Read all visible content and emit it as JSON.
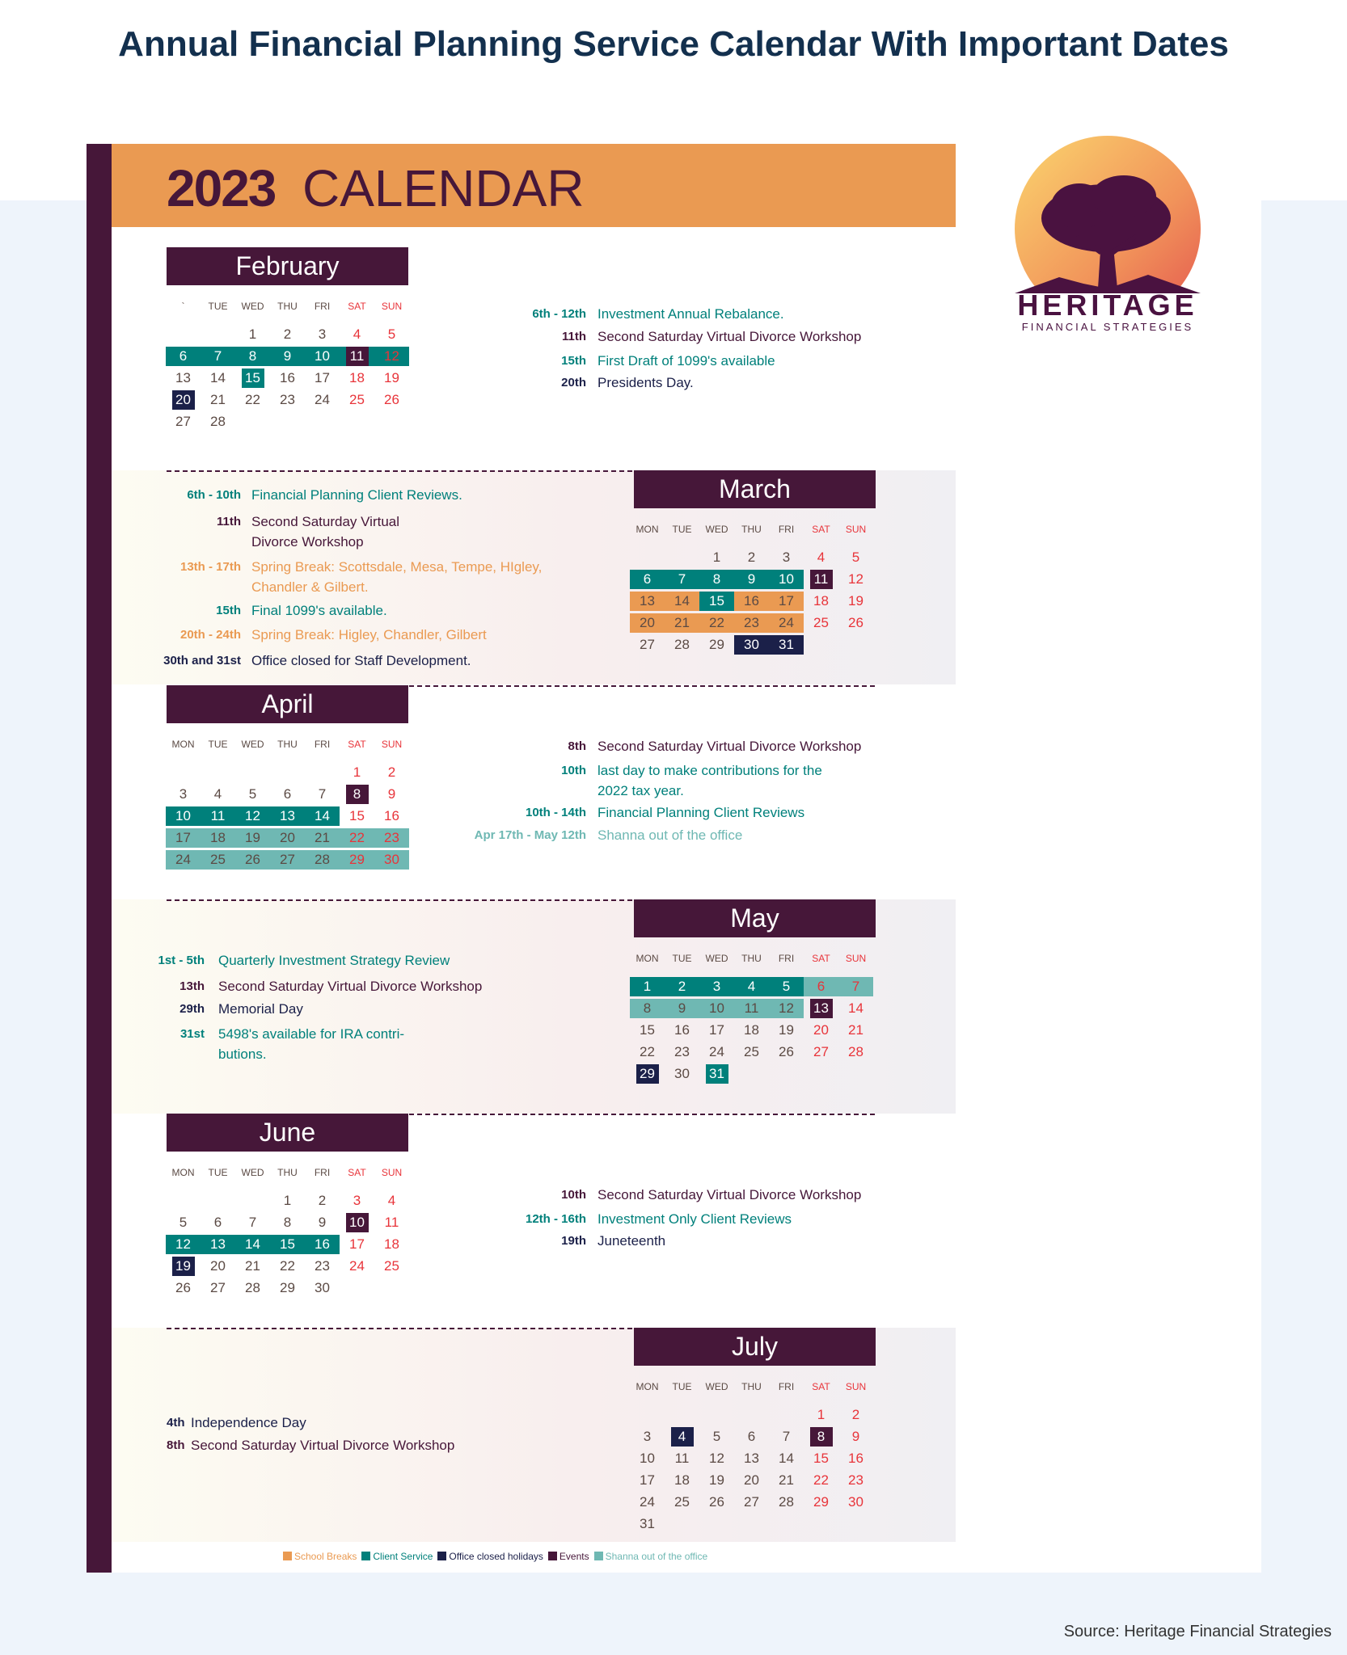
{
  "title": "Annual Financial Planning Service Calendar With Important Dates",
  "header": {
    "year": "2023",
    "label": "CALENDAR"
  },
  "logo": {
    "name": "HERITAGE",
    "tagline": "FINANCIAL STRATEGIES"
  },
  "colors": {
    "client": "#00807b",
    "events": "#461739",
    "office": "#1b2049",
    "school": "#ea9a52",
    "shanna": "#6fb8b3",
    "weekend": "#e8343a",
    "text": "#5b4a44"
  },
  "months": [
    {
      "name": "February",
      "weekdays": [
        "`",
        "TUE",
        "WED",
        "THU",
        "FRI",
        "SAT",
        "SUN"
      ],
      "offset": 2,
      "days": 28,
      "highlights": [
        {
          "from": 6,
          "to": 12,
          "cat": "client"
        },
        {
          "from": 11,
          "to": 11,
          "cat": "events"
        },
        {
          "from": 15,
          "to": 15,
          "cat": "client"
        },
        {
          "from": 20,
          "to": 20,
          "cat": "office"
        }
      ],
      "notes": [
        {
          "date": "6th - 12th",
          "lines": [
            "Investment Annual Rebalance."
          ],
          "cat": "client"
        },
        {
          "date": "11th",
          "lines": [
            "Second Saturday Virtual Divorce Workshop"
          ],
          "cat": "events"
        },
        {
          "date": "15th",
          "lines": [
            "First Draft of 1099's available"
          ],
          "cat": "client"
        },
        {
          "date": "20th",
          "lines": [
            "Presidents Day."
          ],
          "cat": "office"
        }
      ]
    },
    {
      "name": "March",
      "weekdays": [
        "MON",
        "TUE",
        "WED",
        "THU",
        "FRI",
        "SAT",
        "SUN"
      ],
      "offset": 2,
      "days": 31,
      "highlights": [
        {
          "from": 6,
          "to": 10,
          "cat": "client"
        },
        {
          "from": 11,
          "to": 11,
          "cat": "events"
        },
        {
          "from": 13,
          "to": 17,
          "cat": "school"
        },
        {
          "from": 15,
          "to": 15,
          "cat": "clientfull"
        },
        {
          "from": 20,
          "to": 24,
          "cat": "school"
        },
        {
          "from": 30,
          "to": 31,
          "cat": "office"
        }
      ],
      "notes": [
        {
          "date": "6th - 10th",
          "lines": [
            "Financial Planning Client Reviews."
          ],
          "cat": "client"
        },
        {
          "date": "11th",
          "lines": [
            "Second Saturday Virtual",
            "Divorce Workshop"
          ],
          "cat": "events"
        },
        {
          "date": "13th - 17th",
          "lines": [
            "Spring Break: Scottsdale, Mesa, Tempe, HIgley,",
            "Chandler & Gilbert."
          ],
          "cat": "school"
        },
        {
          "date": "15th",
          "lines": [
            "Final 1099's available."
          ],
          "cat": "client"
        },
        {
          "date": "20th - 24th",
          "lines": [
            "Spring Break: Higley, Chandler, Gilbert"
          ],
          "cat": "school"
        },
        {
          "date": "30th and 31st",
          "lines": [
            "Office closed for Staff Development."
          ],
          "cat": "office"
        }
      ]
    },
    {
      "name": "April",
      "weekdays": [
        "MON",
        "TUE",
        "WED",
        "THU",
        "FRI",
        "SAT",
        "SUN"
      ],
      "offset": 5,
      "days": 30,
      "highlights": [
        {
          "from": 8,
          "to": 8,
          "cat": "events"
        },
        {
          "from": 10,
          "to": 14,
          "cat": "client"
        },
        {
          "from": 17,
          "to": 30,
          "cat": "shanna"
        }
      ],
      "notes": [
        {
          "date": "8th",
          "lines": [
            "Second Saturday Virtual Divorce Workshop"
          ],
          "cat": "events"
        },
        {
          "date": "10th",
          "lines": [
            "last day to make contributions for the",
            "2022 tax year."
          ],
          "cat": "client"
        },
        {
          "date": "10th - 14th",
          "lines": [
            "Financial Planning Client Reviews"
          ],
          "cat": "client"
        },
        {
          "date": "Apr 17th - May 12th",
          "lines": [
            "Shanna out of the office"
          ],
          "cat": "shanna"
        }
      ]
    },
    {
      "name": "May",
      "weekdays": [
        "MON",
        "TUE",
        "WED",
        "THU",
        "FRI",
        "SAT",
        "SUN"
      ],
      "offset": 0,
      "days": 31,
      "highlights": [
        {
          "from": 1,
          "to": 5,
          "cat": "client"
        },
        {
          "from": 6,
          "to": 12,
          "cat": "shanna"
        },
        {
          "from": 13,
          "to": 13,
          "cat": "events"
        },
        {
          "from": 29,
          "to": 29,
          "cat": "office"
        },
        {
          "from": 31,
          "to": 31,
          "cat": "client"
        }
      ],
      "notes": [
        {
          "date": "1st - 5th",
          "lines": [
            "Quarterly Investment Strategy Review"
          ],
          "cat": "client"
        },
        {
          "date": "13th",
          "lines": [
            "Second Saturday Virtual Divorce Workshop"
          ],
          "cat": "events"
        },
        {
          "date": "29th",
          "lines": [
            "Memorial Day"
          ],
          "cat": "office"
        },
        {
          "date": "31st",
          "lines": [
            "5498's available for IRA contri-",
            "butions."
          ],
          "cat": "client"
        }
      ]
    },
    {
      "name": "June",
      "weekdays": [
        "MON",
        "TUE",
        "WED",
        "THU",
        "FRI",
        "SAT",
        "SUN"
      ],
      "offset": 3,
      "days": 30,
      "highlights": [
        {
          "from": 10,
          "to": 10,
          "cat": "events"
        },
        {
          "from": 12,
          "to": 16,
          "cat": "client"
        },
        {
          "from": 19,
          "to": 19,
          "cat": "office"
        }
      ],
      "notes": [
        {
          "date": "10th",
          "lines": [
            "Second Saturday Virtual Divorce Workshop"
          ],
          "cat": "events"
        },
        {
          "date": "12th - 16th",
          "lines": [
            "Investment Only Client Reviews"
          ],
          "cat": "client"
        },
        {
          "date": "19th",
          "lines": [
            "Juneteenth"
          ],
          "cat": "office"
        }
      ]
    },
    {
      "name": "July",
      "weekdays": [
        "MON",
        "TUE",
        "WED",
        "THU",
        "FRI",
        "SAT",
        "SUN"
      ],
      "offset": 5,
      "days": 31,
      "highlights": [
        {
          "from": 4,
          "to": 4,
          "cat": "office"
        },
        {
          "from": 8,
          "to": 8,
          "cat": "events"
        }
      ],
      "notes": [
        {
          "date": "4th",
          "lines": [
            "Independence Day"
          ],
          "cat": "office"
        },
        {
          "date": "8th",
          "lines": [
            "Second Saturday Virtual Divorce Workshop"
          ],
          "cat": "events"
        }
      ]
    }
  ],
  "legend": [
    {
      "label": "School Breaks",
      "cat": "school"
    },
    {
      "label": "Client Service",
      "cat": "client"
    },
    {
      "label": "Office closed holidays",
      "cat": "office"
    },
    {
      "label": "Events",
      "cat": "events"
    },
    {
      "label": "Shanna out of the office",
      "cat": "shanna"
    }
  ],
  "source": "Source: Heritage Financial Strategies"
}
